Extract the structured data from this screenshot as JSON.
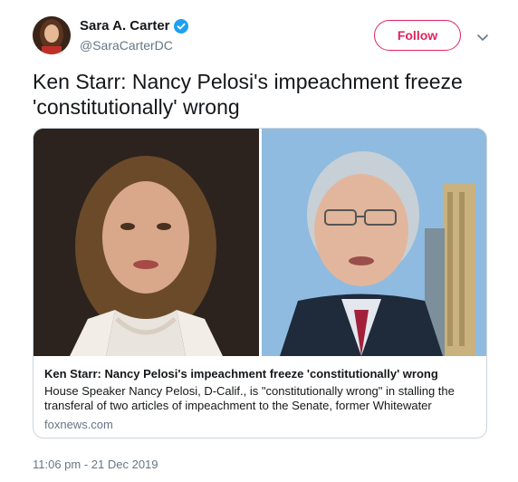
{
  "author": {
    "display_name": "Sara A. Carter",
    "handle": "@SaraCarterDC",
    "verified": true,
    "avatar_icon": "avatar-photo"
  },
  "actions": {
    "follow_label": "Follow",
    "menu_icon": "chevron-down-icon",
    "accent_color": "#e0245e"
  },
  "tweet": {
    "text": "Ken Starr: Nancy Pelosi's impeachment freeze 'constitutionally' wrong",
    "timestamp": "11:06 pm - 21 Dec 2019"
  },
  "card": {
    "title": "Ken Starr: Nancy Pelosi's impeachment freeze 'constitutionally' wrong",
    "description": "House Speaker Nancy Pelosi, D-Calif., is \"constitutionally wrong\" in stalling the transferal of two articles of impeachment to the Senate, former Whitewater",
    "domain": "foxnews.com"
  }
}
